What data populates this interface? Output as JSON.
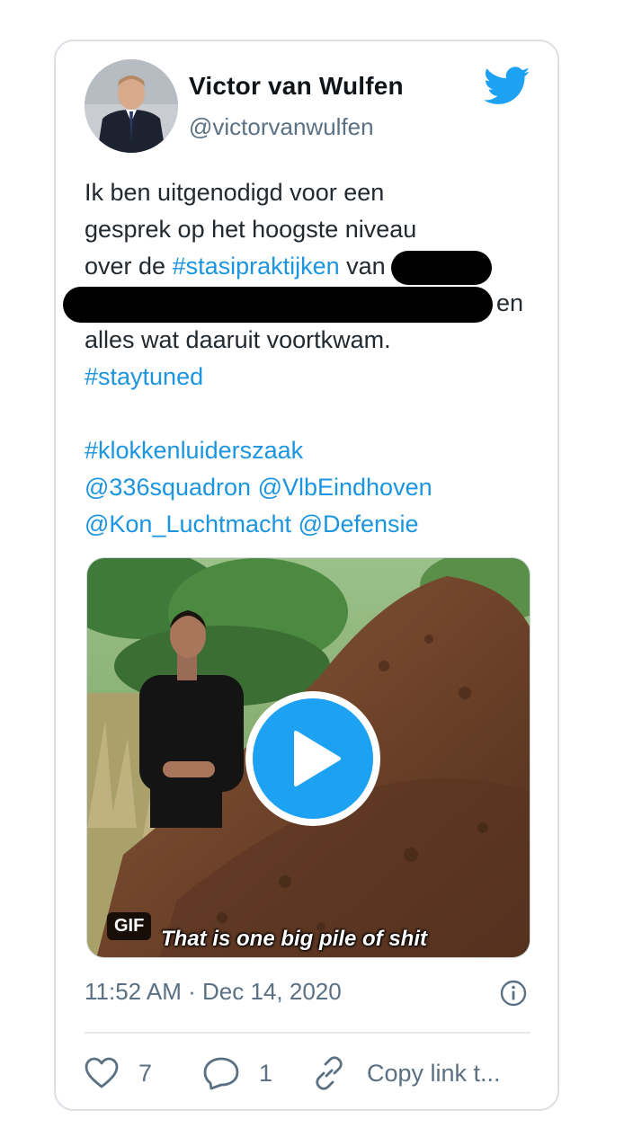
{
  "tweet": {
    "author_name": "Victor van Wulfen",
    "author_handle": "@victorvanwulfen",
    "text": {
      "line1": "Ik ben uitgenodigd voor een",
      "line2": "gesprek op het hoogste niveau",
      "line3_pre": "over de ",
      "line3_hashtag": "#stasipraktijken",
      "line3_post": " van",
      "line4_post": "en",
      "line5": "alles wat daaruit voortkwam.",
      "line6_hashtag": "#staytuned",
      "line8_hashtag": "#klokkenluiderszaak",
      "mention1": "@336squadron",
      "mention2": "@VlbEindhoven",
      "mention3": "@Kon_Luchtmacht",
      "mention4": "@Defensie"
    },
    "media": {
      "badge": "GIF",
      "caption": "That is one big pile of shit"
    },
    "timestamp": "11:52 AM · Dec 14, 2020",
    "likes": "7",
    "replies": "1",
    "copy_link_label": "Copy link t..."
  },
  "colors": {
    "link": "#1b95e0",
    "twitter_blue": "#1da1f2",
    "muted": "#5b7083"
  },
  "icons": [
    "twitter-bird-icon",
    "play-icon",
    "info-icon",
    "heart-icon",
    "reply-icon",
    "link-icon"
  ]
}
